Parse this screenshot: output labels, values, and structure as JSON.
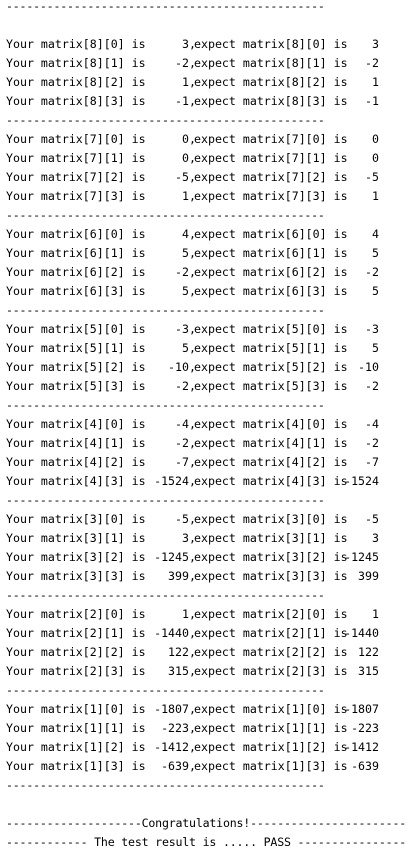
{
  "separator": "-----------------------------------------------",
  "blocks": [
    {
      "rows": [
        {
          "label": "Your matrix[8][0] is",
          "value": "3",
          "expect": "expect matrix[8][0] is",
          "expected": "3"
        },
        {
          "label": "Your matrix[8][1] is",
          "value": "-2",
          "expect": "expect matrix[8][1] is",
          "expected": "-2"
        },
        {
          "label": "Your matrix[8][2] is",
          "value": "1",
          "expect": "expect matrix[8][2] is",
          "expected": "1"
        },
        {
          "label": "Your matrix[8][3] is",
          "value": "-1",
          "expect": "expect matrix[8][3] is",
          "expected": "-1"
        }
      ]
    },
    {
      "rows": [
        {
          "label": "Your matrix[7][0] is",
          "value": "0",
          "expect": "expect matrix[7][0] is",
          "expected": "0"
        },
        {
          "label": "Your matrix[7][1] is",
          "value": "0",
          "expect": "expect matrix[7][1] is",
          "expected": "0"
        },
        {
          "label": "Your matrix[7][2] is",
          "value": "-5",
          "expect": "expect matrix[7][2] is",
          "expected": "-5"
        },
        {
          "label": "Your matrix[7][3] is",
          "value": "1",
          "expect": "expect matrix[7][3] is",
          "expected": "1"
        }
      ]
    },
    {
      "rows": [
        {
          "label": "Your matrix[6][0] is",
          "value": "4",
          "expect": "expect matrix[6][0] is",
          "expected": "4"
        },
        {
          "label": "Your matrix[6][1] is",
          "value": "5",
          "expect": "expect matrix[6][1] is",
          "expected": "5"
        },
        {
          "label": "Your matrix[6][2] is",
          "value": "-2",
          "expect": "expect matrix[6][2] is",
          "expected": "-2"
        },
        {
          "label": "Your matrix[6][3] is",
          "value": "5",
          "expect": "expect matrix[6][3] is",
          "expected": "5"
        }
      ]
    },
    {
      "rows": [
        {
          "label": "Your matrix[5][0] is",
          "value": "-3",
          "expect": "expect matrix[5][0] is",
          "expected": "-3"
        },
        {
          "label": "Your matrix[5][1] is",
          "value": "5",
          "expect": "expect matrix[5][1] is",
          "expected": "5"
        },
        {
          "label": "Your matrix[5][2] is",
          "value": "-10",
          "expect": "expect matrix[5][2] is",
          "expected": "-10"
        },
        {
          "label": "Your matrix[5][3] is",
          "value": "-2",
          "expect": "expect matrix[5][3] is",
          "expected": "-2"
        }
      ]
    },
    {
      "rows": [
        {
          "label": "Your matrix[4][0] is",
          "value": "-4",
          "expect": "expect matrix[4][0] is",
          "expected": "-4"
        },
        {
          "label": "Your matrix[4][1] is",
          "value": "-2",
          "expect": "expect matrix[4][1] is",
          "expected": "-2"
        },
        {
          "label": "Your matrix[4][2] is",
          "value": "-7",
          "expect": "expect matrix[4][2] is",
          "expected": "-7"
        },
        {
          "label": "Your matrix[4][3] is",
          "value": "-1524",
          "expect": "expect matrix[4][3] is",
          "expected": "-1524"
        }
      ]
    },
    {
      "rows": [
        {
          "label": "Your matrix[3][0] is",
          "value": "-5",
          "expect": "expect matrix[3][0] is",
          "expected": "-5"
        },
        {
          "label": "Your matrix[3][1] is",
          "value": "3",
          "expect": "expect matrix[3][1] is",
          "expected": "3"
        },
        {
          "label": "Your matrix[3][2] is",
          "value": "-1245",
          "expect": "expect matrix[3][2] is",
          "expected": "-1245"
        },
        {
          "label": "Your matrix[3][3] is",
          "value": "399",
          "expect": "expect matrix[3][3] is",
          "expected": "399"
        }
      ]
    },
    {
      "rows": [
        {
          "label": "Your matrix[2][0] is",
          "value": "1",
          "expect": "expect matrix[2][0] is",
          "expected": "1"
        },
        {
          "label": "Your matrix[2][1] is",
          "value": "-1440",
          "expect": "expect matrix[2][1] is",
          "expected": "-1440"
        },
        {
          "label": "Your matrix[2][2] is",
          "value": "122",
          "expect": "expect matrix[2][2] is",
          "expected": "122"
        },
        {
          "label": "Your matrix[2][3] is",
          "value": "315",
          "expect": "expect matrix[2][3] is",
          "expected": "315"
        }
      ]
    },
    {
      "rows": [
        {
          "label": "Your matrix[1][0] is",
          "value": "-1807",
          "expect": "expect matrix[1][0] is",
          "expected": "-1807"
        },
        {
          "label": "Your matrix[1][1] is",
          "value": "-223",
          "expect": "expect matrix[1][1] is",
          "expected": "-223"
        },
        {
          "label": "Your matrix[1][2] is",
          "value": "-1412",
          "expect": "expect matrix[1][2] is",
          "expected": "-1412"
        },
        {
          "label": "Your matrix[1][3] is",
          "value": "-639",
          "expect": "expect matrix[1][3] is",
          "expected": "-639"
        }
      ]
    }
  ],
  "footer": {
    "congrats": "--------------------Congratulations!------------------------",
    "result": "------------ The test result is ..... PASS ----------------"
  }
}
